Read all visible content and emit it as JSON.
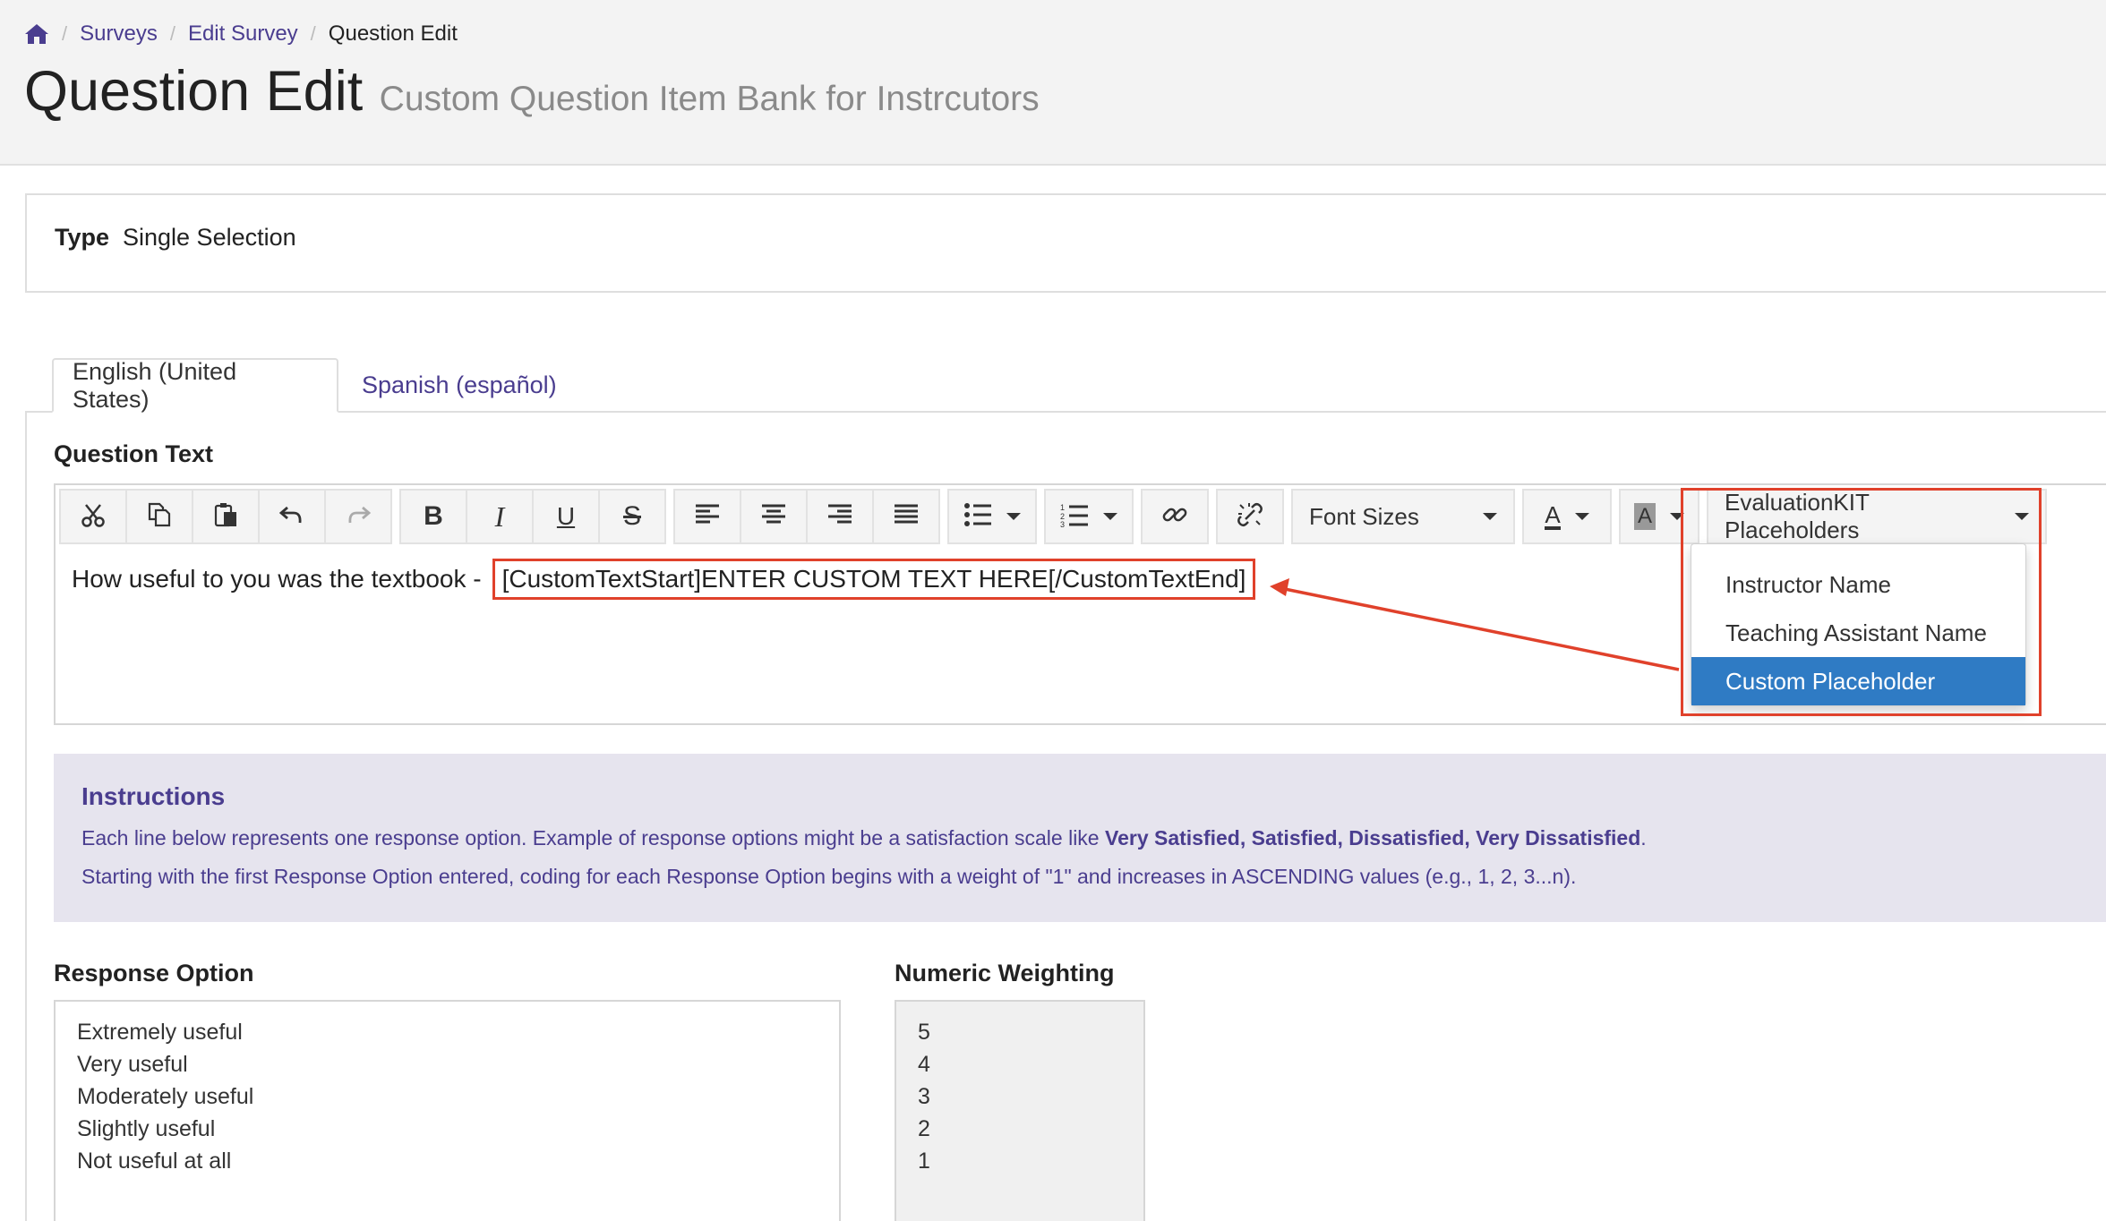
{
  "breadcrumb": {
    "items": [
      "Surveys",
      "Edit Survey"
    ],
    "current": "Question Edit"
  },
  "page": {
    "title": "Question Edit",
    "subtitle": "Custom Question Item Bank for Instrcutors"
  },
  "type_panel": {
    "label": "Type",
    "value": "Single Selection"
  },
  "tabs": [
    {
      "label": "English (United States)",
      "active": true
    },
    {
      "label": "Spanish (español)",
      "active": false
    }
  ],
  "question_text": {
    "label": "Question Text",
    "toolbar": {
      "font_sizes_label": "Font Sizes",
      "font_color_glyph": "A",
      "bg_color_glyph": "A",
      "placeholders_label": "EvaluationKIT Placeholders",
      "icons": [
        "scissors-icon",
        "copy-icon",
        "paste-icon",
        "undo-icon",
        "redo-icon",
        "bold-icon",
        "italic-icon",
        "underline-icon",
        "strikethrough-icon",
        "align-left-icon",
        "align-center-icon",
        "align-right-icon",
        "align-justify-icon",
        "bullet-list-icon",
        "numbered-list-icon",
        "link-icon",
        "unlink-icon"
      ]
    },
    "body_text": "How useful to you was the textbook -",
    "custom_token": "[CustomTextStart]ENTER CUSTOM TEXT HERE[/CustomTextEnd]"
  },
  "placeholder_menu": {
    "items": [
      "Instructor Name",
      "Teaching Assistant Name",
      "Custom Placeholder"
    ],
    "selected": "Custom Placeholder"
  },
  "instructions": {
    "title": "Instructions",
    "line1_prefix": "Each line below represents one response option. Example of response options might be a satisfaction scale like ",
    "line1_bold": "Very Satisfied, Satisfied, Dissatisfied, Very Dissatisfied",
    "line1_suffix": ".",
    "line2": "Starting with the first Response Option entered, coding for each Response Option begins with a weight of \"1\" and increases in ASCENDING values (e.g., 1, 2, 3...n)."
  },
  "response_options": {
    "label": "Response Option",
    "items": [
      "Extremely useful",
      "Very useful",
      "Moderately useful",
      "Slightly useful",
      "Not useful at all"
    ]
  },
  "numeric_weighting": {
    "label": "Numeric Weighting",
    "items": [
      "5",
      "4",
      "3",
      "2",
      "1"
    ]
  },
  "colors": {
    "accent": "#4a3d8f",
    "highlight_red": "#e0412b",
    "menu_selected": "#2f7bc4",
    "instructions_bg": "#e6e4ee"
  }
}
